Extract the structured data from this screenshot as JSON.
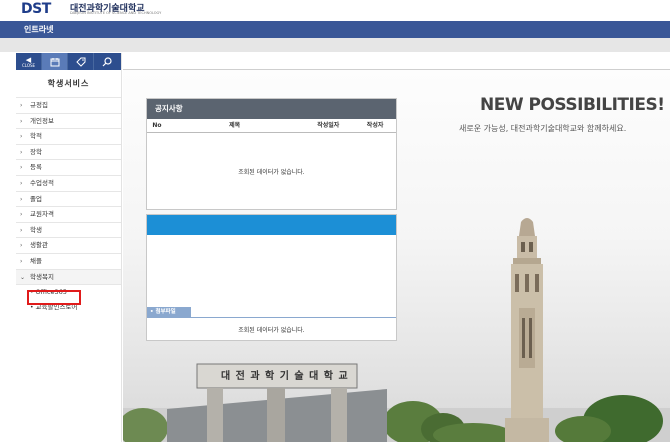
{
  "header": {
    "logo_mark": "DST",
    "logo_text": "대전과학기술대학교",
    "logo_subtext": "DAEJEON INSTITUTE OF SCIENCE AND TECHNOLOGY",
    "bar_title": "인트라넷"
  },
  "sidebar": {
    "tools": [
      {
        "label": "◀",
        "sub": "CLOSE",
        "icon": "close-icon"
      },
      {
        "label": "▦",
        "sub": "",
        "icon": "calendar-icon"
      },
      {
        "label": "⌂",
        "sub": "",
        "icon": "tag-icon"
      },
      {
        "label": "⚲",
        "sub": "",
        "icon": "search-icon"
      }
    ],
    "title": "학생서비스",
    "items": [
      {
        "label": "규정집"
      },
      {
        "label": "개인정보"
      },
      {
        "label": "학적"
      },
      {
        "label": "장학"
      },
      {
        "label": "등록"
      },
      {
        "label": "수업성적"
      },
      {
        "label": "졸업"
      },
      {
        "label": "교원자격"
      },
      {
        "label": "학생"
      },
      {
        "label": "생활관"
      },
      {
        "label": "채플"
      },
      {
        "label": "학생복지"
      }
    ],
    "subitems": [
      {
        "label": "Office365"
      },
      {
        "label": "교육할인스토어"
      }
    ]
  },
  "main": {
    "headline": "NEW POSSIBILITIES!",
    "subline": "새로운 가능성, 대전과학기술대학교와 함께하세요.",
    "gate_text": "대 전 과 학 기 술 대 학 교"
  },
  "notice": {
    "title": "공지사항",
    "columns": [
      "No",
      "제목",
      "작성일자",
      "작성자"
    ],
    "empty": "조회된 데이터가 없습니다."
  },
  "panel2": {
    "attach_label": "첨부파일",
    "empty": "조회된 데이터가 없습니다."
  },
  "colors": {
    "header_blue": "#3a5797",
    "sidebar_dark": "#2d4e8e",
    "notice_head": "#5b6470",
    "panel_blue": "#1c8fd6",
    "highlight_red": "#e01b1b"
  }
}
